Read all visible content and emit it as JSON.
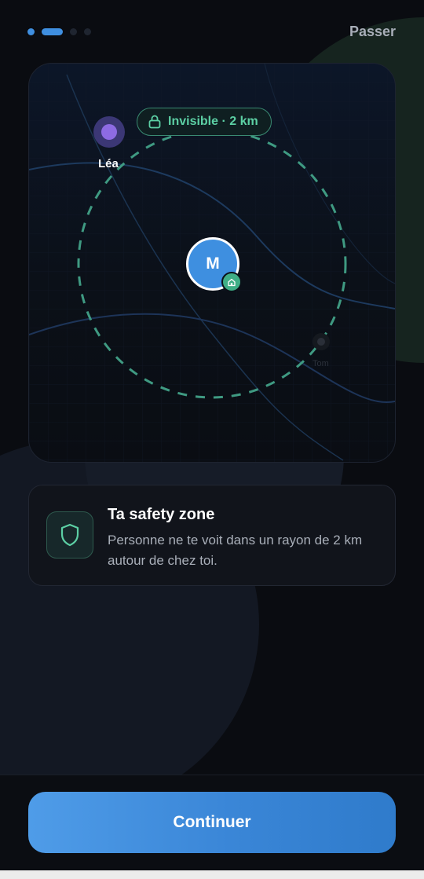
{
  "header": {
    "skip_label": "Passer",
    "progress": {
      "total_steps": 4,
      "current_step": 2
    }
  },
  "map": {
    "badge": {
      "icon": "lock-icon",
      "label": "Invisible · 2 km"
    },
    "friends": [
      {
        "name": "Léa",
        "color": "#8d6be3"
      },
      {
        "name": "Tom"
      }
    ],
    "me": {
      "initial": "M",
      "home_icon": "home-icon"
    }
  },
  "info": {
    "icon": "shield-icon",
    "title": "Ta safety zone",
    "description": "Personne ne te voit dans un rayon de 2 km autour de chez toi."
  },
  "footer": {
    "continue_label": "Continuer"
  },
  "colors": {
    "accent": "#3f8fe0",
    "safe_green": "#5ccfa4",
    "background": "#0a0c11"
  }
}
